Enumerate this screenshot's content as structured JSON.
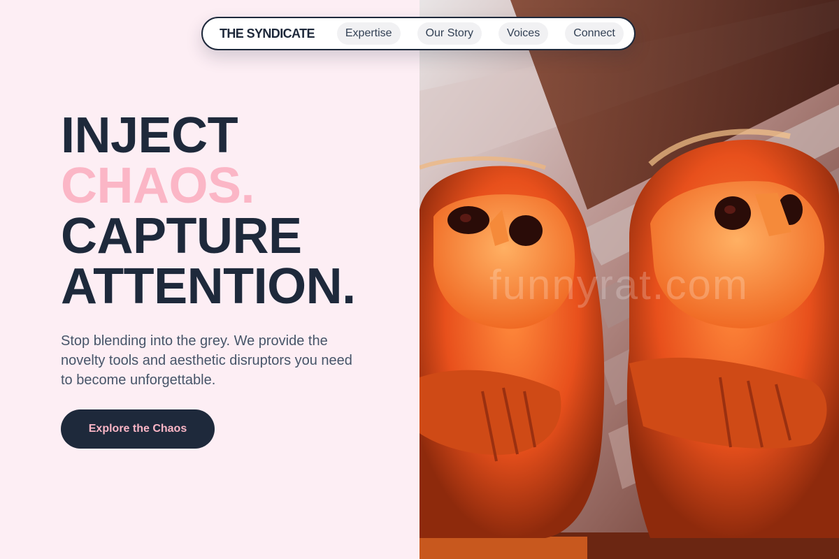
{
  "nav": {
    "brand": "THE SYNDICATE",
    "items": [
      {
        "label": "Expertise"
      },
      {
        "label": "Our Story"
      },
      {
        "label": "Voices"
      },
      {
        "label": "Connect"
      }
    ]
  },
  "hero": {
    "line1": "INJECT",
    "line2": "CHAOS.",
    "line3": "CAPTURE",
    "line4": "ATTENTION.",
    "subtext": "Stop blending into the grey. We provide the novelty tools and aesthetic disruptors you need to become unforgettable.",
    "cta_label": "Explore the Chaos"
  },
  "image": {
    "subject": "two carved coconut-husk monkey figurines",
    "watermark": "funnyrat.com"
  },
  "colors": {
    "background": "#fdeef4",
    "navy": "#1e293b",
    "accent_pink": "#fbb6c6",
    "body_text": "#475569"
  }
}
